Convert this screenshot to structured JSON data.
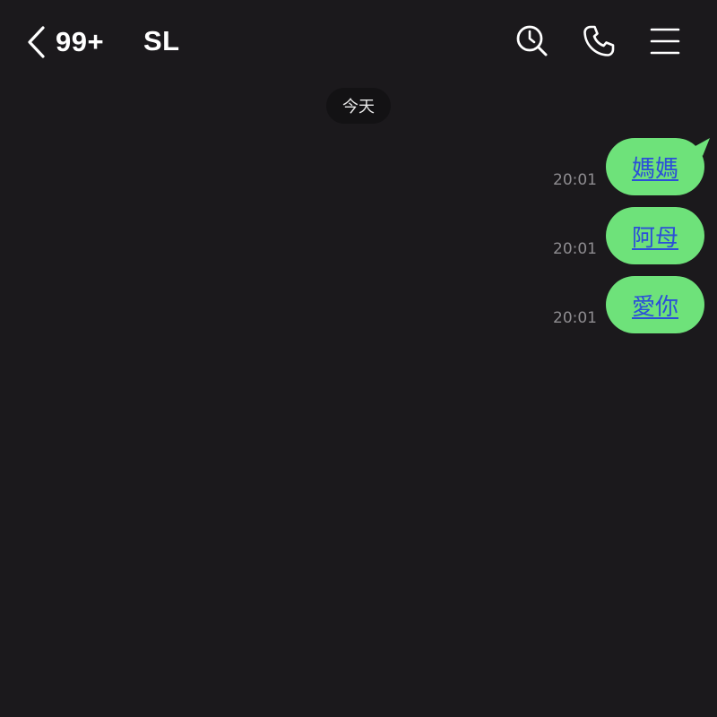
{
  "header": {
    "unread_count": "99+",
    "chat_title": "SL",
    "icons": {
      "back": "chevron-left-icon",
      "search": "clock-search-icon",
      "call": "phone-icon",
      "menu": "hamburger-menu-icon"
    }
  },
  "date_separator": "今天",
  "messages": [
    {
      "text": "媽媽",
      "time": "20:01"
    },
    {
      "text": "阿母",
      "time": "20:01"
    },
    {
      "text": "愛你",
      "time": "20:01"
    }
  ],
  "colors": {
    "background": "#1b191c",
    "bubble": "#6ee27a",
    "link_text": "#2b4fd8",
    "time_text": "#8e8c90",
    "date_pill": "#131214"
  }
}
